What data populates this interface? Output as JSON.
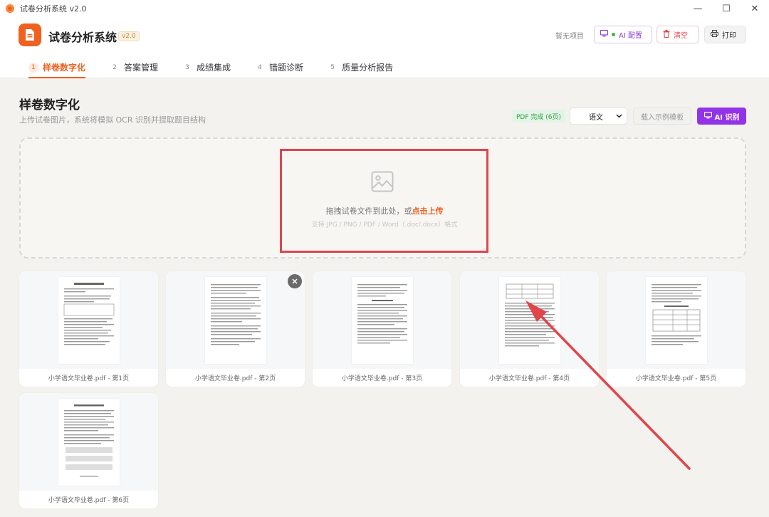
{
  "window": {
    "title": "试卷分析系统 v2.0",
    "controls": {
      "minimize": "—",
      "maximize": "☐",
      "close": "✕"
    }
  },
  "header": {
    "app_title": "试卷分析系统",
    "version": "v2.0",
    "project_status": "暂无项目",
    "ai_config_label": "AI 配置",
    "clear_label": "清空",
    "print_label": "打印"
  },
  "tabs": [
    {
      "num": "1",
      "label": "样卷数字化",
      "active": true
    },
    {
      "num": "2",
      "label": "答案管理"
    },
    {
      "num": "3",
      "label": "成绩集成"
    },
    {
      "num": "4",
      "label": "错题诊断"
    },
    {
      "num": "5",
      "label": "质量分析报告"
    }
  ],
  "page": {
    "title": "样卷数字化",
    "subtitle": "上传试卷图片，系统将模拟 OCR 识别并提取题目结构",
    "pdf_status": "PDF 完成 (6页)",
    "language_selected": "语文",
    "load_sample_label": "载入示例模板",
    "ocr_label": "AI 识别"
  },
  "upload": {
    "prompt": "拖拽试卷文件到此处，或",
    "link": "点击上传",
    "formats": "支持 JPG / PNG / PDF / Word（.doc/.docx）格式"
  },
  "pages": [
    {
      "caption": "小学语文毕业卷.pdf - 第1页"
    },
    {
      "caption": "小学语文毕业卷.pdf - 第2页"
    },
    {
      "caption": "小学语文毕业卷.pdf - 第3页"
    },
    {
      "caption": "小学语文毕业卷.pdf - 第4页"
    },
    {
      "caption": "小学语文毕业卷.pdf - 第5页"
    },
    {
      "caption": "小学语文毕业卷.pdf - 第6页"
    }
  ],
  "colors": {
    "accent": "#f0611f",
    "ai_purple": "#9233e8",
    "danger": "#e04848",
    "annotation_red": "#e0454a"
  },
  "icons": {
    "logo": "document-icon",
    "ai_config": "monitor-icon",
    "clear": "trash-icon",
    "print": "printer-icon",
    "upload": "image-icon",
    "delete": "close-icon"
  }
}
